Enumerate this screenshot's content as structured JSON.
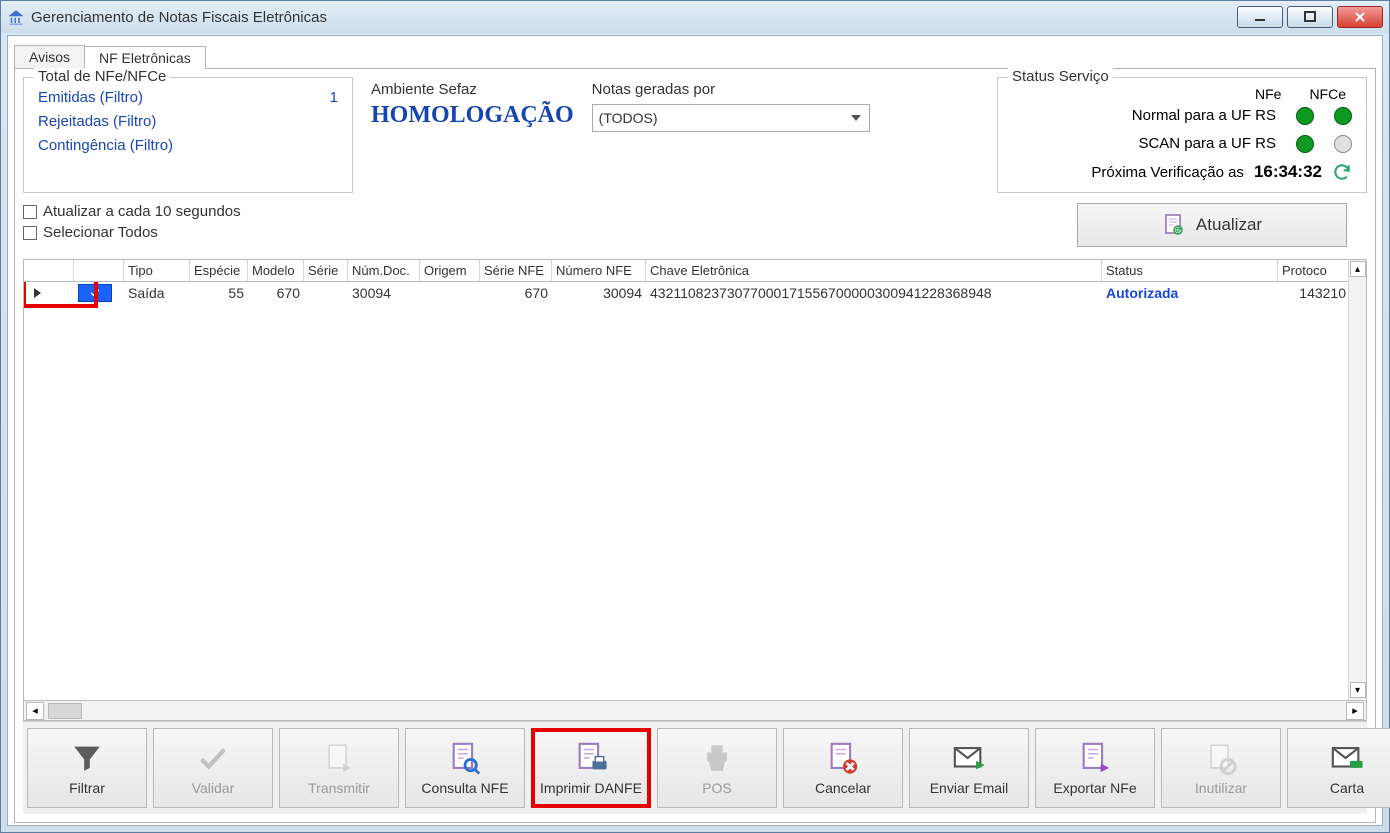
{
  "window": {
    "title": "Gerenciamento de Notas Fiscais Eletrônicas"
  },
  "tabs": {
    "avisos": "Avisos",
    "nfe": "NF Eletrônicas"
  },
  "totals": {
    "legend": "Total de NFe/NFCe",
    "emitidas_label": "Emitidas (Filtro)",
    "emitidas_value": "1",
    "rejeitadas_label": "Rejeitadas (Filtro)",
    "contingencia_label": "Contingência (Filtro)"
  },
  "ambiente": {
    "label": "Ambiente Sefaz",
    "value": "HOMOLOGAÇÃO"
  },
  "notas_por": {
    "label": "Notas geradas por",
    "selected": "(TODOS)"
  },
  "status_serv": {
    "legend": "Status Serviço",
    "col_nfe": "NFe",
    "col_nfce": "NFCe",
    "row1": "Normal para a UF RS",
    "row2": "SCAN para a UF RS",
    "prox_label": "Próxima Verificação as",
    "prox_time": "16:34:32"
  },
  "checks": {
    "auto": "Atualizar a cada 10 segundos",
    "seltodos": "Selecionar Todos"
  },
  "atualizar_btn": "Atualizar",
  "grid": {
    "headers": {
      "tipo": "Tipo",
      "especie": "Espécie",
      "modelo": "Modelo",
      "serie": "Série",
      "numdoc": "Núm.Doc.",
      "origem": "Origem",
      "serie_nfe": "Série NFE",
      "numero_nfe": "Número NFE",
      "chave": "Chave Eletrônica",
      "status": "Status",
      "protocolo": "Protoco"
    },
    "row": {
      "tipo": "Saída",
      "especie": "55",
      "modelo": "670",
      "numdoc": "30094",
      "serie_nfe": "670",
      "numero_nfe": "30094",
      "chave": "43211082373077000171556700000300941228368948",
      "status": "Autorizada",
      "protocolo": "143210"
    }
  },
  "toolbar": {
    "filtrar": "Filtrar",
    "validar": "Validar",
    "transmitir": "Transmitir",
    "consulta": "Consulta NFE",
    "imprimir": "Imprimir DANFE",
    "pos": "POS",
    "cancelar": "Cancelar",
    "email": "Enviar Email",
    "exportar": "Exportar NFe",
    "inutilizar": "Inutilizar",
    "carta": "Carta"
  }
}
